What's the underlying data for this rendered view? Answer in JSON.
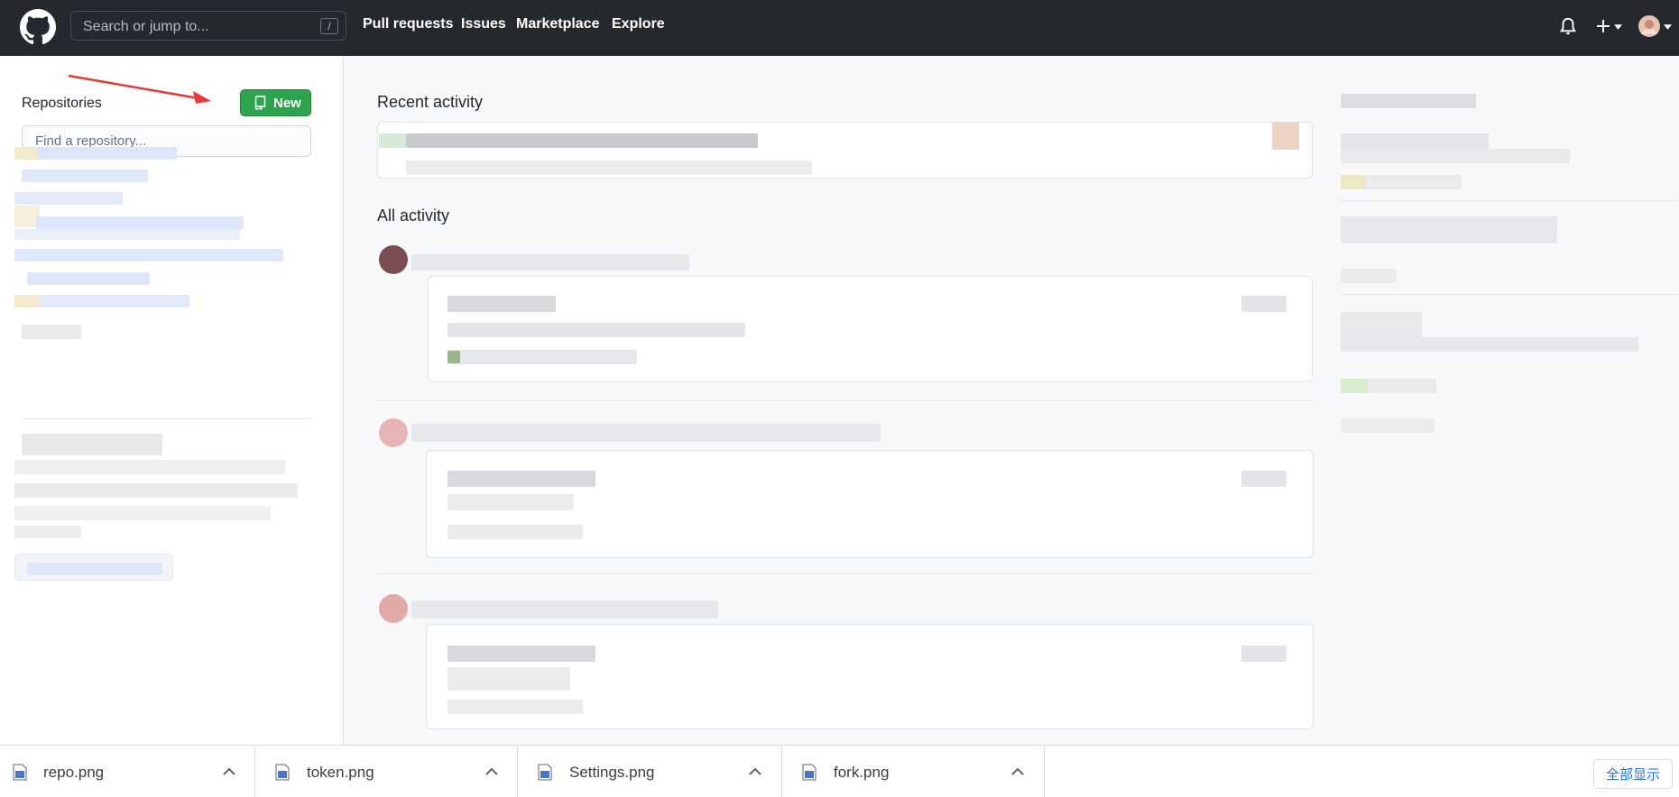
{
  "header": {
    "search_placeholder": "Search or jump to...",
    "slash_hint": "/",
    "nav": [
      "Pull requests",
      "Issues",
      "Marketplace",
      "Explore"
    ],
    "plus_symbol": "+",
    "icons": [
      "github-logo-icon",
      "bell-icon",
      "plus-icon",
      "avatar"
    ]
  },
  "sidebar": {
    "title": "Repositories",
    "new_button": "New",
    "find_placeholder": "Find a repository..."
  },
  "main": {
    "recent_activity": "Recent activity",
    "all_activity": "All activity"
  },
  "downloads": {
    "items": [
      {
        "name": "repo.png"
      },
      {
        "name": "token.png"
      },
      {
        "name": "Settings.png"
      },
      {
        "name": "fork.png"
      }
    ],
    "show_all": "全部显示"
  },
  "colors": {
    "header_bg": "#24292e",
    "new_button_bg": "#2ea44f",
    "annotation_arrow": "#e53935",
    "show_all_text": "#1a73e8"
  }
}
